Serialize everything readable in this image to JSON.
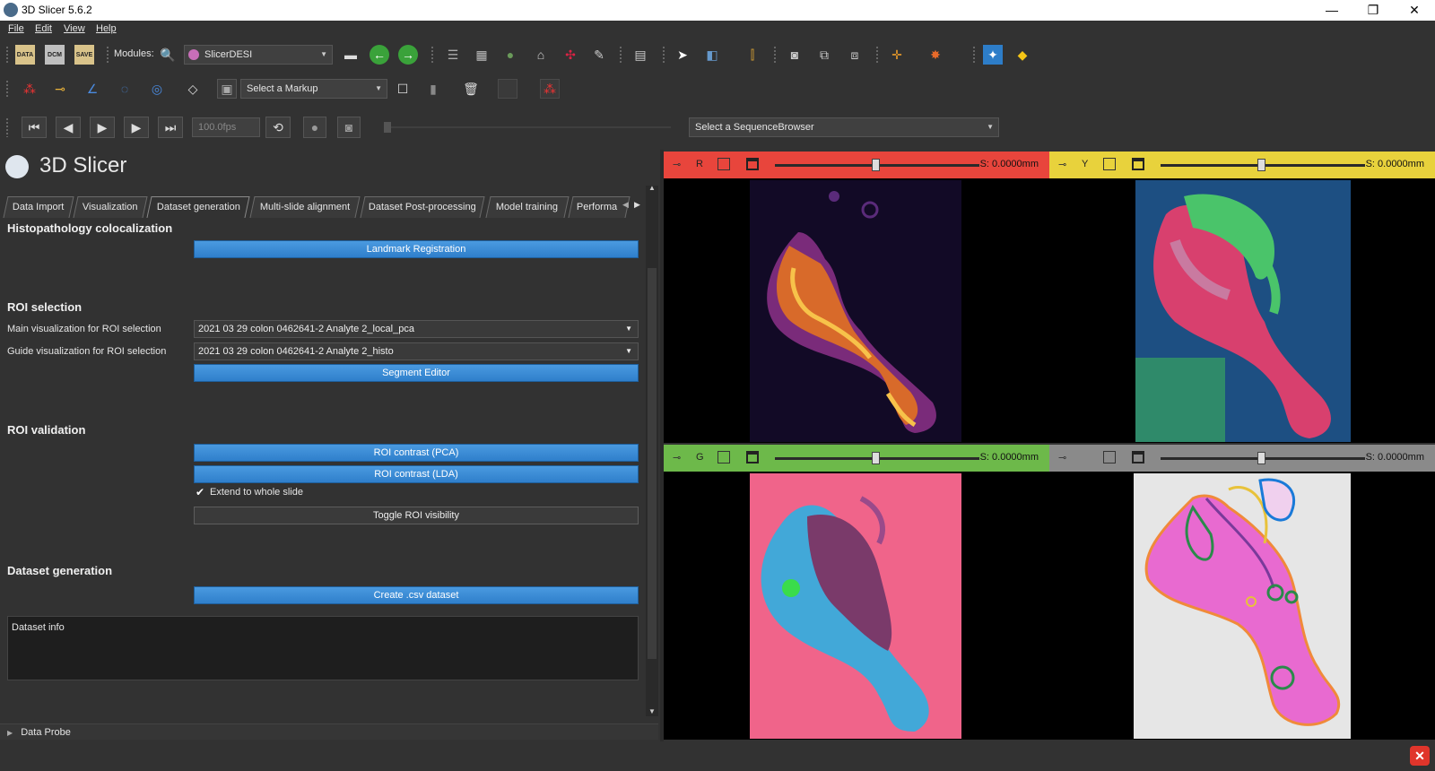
{
  "window": {
    "title": "3D Slicer 5.6.2",
    "minimize": "—",
    "restore": "❐",
    "close": "✕"
  },
  "menu": {
    "items": [
      "File",
      "Edit",
      "View",
      "Help"
    ]
  },
  "toolbar": {
    "modules_label": "Modules:",
    "module_selected": "SlicerDESI",
    "markup_select": "Select a Markup",
    "fps": "100.0fps",
    "sequence_browser": "Select a SequenceBrowser"
  },
  "app": {
    "name": "3D Slicer"
  },
  "tabs": [
    "Data Import",
    "Visualization",
    "Dataset generation",
    "Multi-slide alignment",
    "Dataset Post-processing",
    "Model training",
    "Performa"
  ],
  "active_tab": "Dataset generation",
  "panel": {
    "histo": {
      "title": "Histopathology colocalization",
      "landmark_btn": "Landmark Registration"
    },
    "roi_selection": {
      "title": "ROI selection",
      "main_label": "Main visualization for ROI selection",
      "main_value": "2021 03 29 colon 0462641-2 Analyte 2_local_pca",
      "guide_label": "Guide visualization for ROI selection",
      "guide_value": "2021 03 29 colon 0462641-2 Analyte 2_histo",
      "segment_btn": "Segment Editor"
    },
    "roi_validation": {
      "title": "ROI validation",
      "pca_btn": "ROI contrast (PCA)",
      "lda_btn": "ROI contrast (LDA)",
      "extend_label": "Extend to whole slide",
      "extend_checked": true,
      "toggle_btn": "Toggle ROI visibility"
    },
    "dataset_gen": {
      "title": "Dataset generation",
      "create_btn": "Create .csv dataset",
      "info_text": "Dataset info"
    }
  },
  "data_probe": "Data Probe",
  "viewers": {
    "red": {
      "label": "R",
      "offset": "S: 0.0000mm",
      "color": "#e8453c"
    },
    "yellow": {
      "label": "Y",
      "offset": "S: 0.0000mm",
      "color": "#e8d23c"
    },
    "green": {
      "label": "G",
      "offset": "S: 0.0000mm",
      "color": "#6db94a"
    },
    "gray": {
      "label": "",
      "offset": "S: 0.0000mm",
      "color": "#8a8a8a"
    }
  }
}
